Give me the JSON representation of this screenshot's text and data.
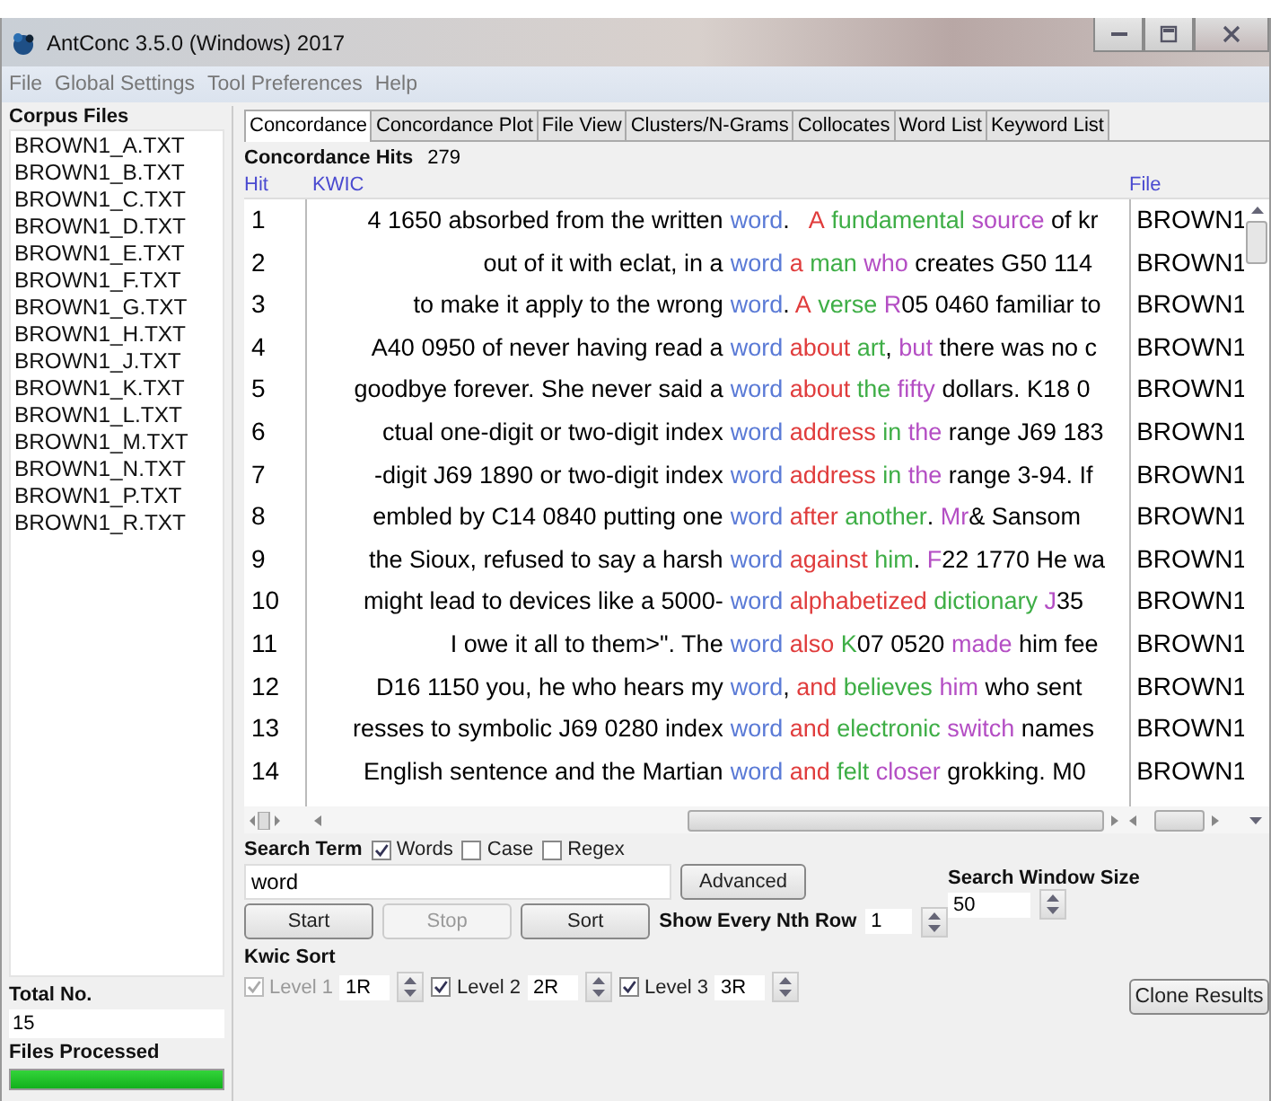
{
  "window": {
    "title": "AntConc 3.5.0 (Windows) 2017"
  },
  "menu": [
    "File",
    "Global Settings",
    "Tool Preferences",
    "Help"
  ],
  "sidebar": {
    "title": "Corpus Files",
    "files": [
      "BROWN1_A.TXT",
      "BROWN1_B.TXT",
      "BROWN1_C.TXT",
      "BROWN1_D.TXT",
      "BROWN1_E.TXT",
      "BROWN1_F.TXT",
      "BROWN1_G.TXT",
      "BROWN1_H.TXT",
      "BROWN1_J.TXT",
      "BROWN1_K.TXT",
      "BROWN1_L.TXT",
      "BROWN1_M.TXT",
      "BROWN1_N.TXT",
      "BROWN1_P.TXT",
      "BROWN1_R.TXT"
    ],
    "total_label": "Total No.",
    "total_value": "15",
    "processed_label": "Files Processed",
    "progress": {
      "level": 1
    }
  },
  "tabs": [
    {
      "label": "Concordance",
      "selected": true
    },
    {
      "label": "Concordance Plot",
      "selected": false
    },
    {
      "label": "File View",
      "selected": false
    },
    {
      "label": "Clusters/N-Grams",
      "selected": false
    },
    {
      "label": "Collocates",
      "selected": false
    },
    {
      "label": "Word List",
      "selected": false
    },
    {
      "label": "Keyword List",
      "selected": false
    }
  ],
  "concordance": {
    "hits_label": "Concordance Hits",
    "hits_value": "279",
    "columns": [
      "Hit",
      "KWIC",
      "File"
    ],
    "rows": [
      {
        "hit": "1",
        "left": "4 1650 absorbed from the written",
        "segments": [
          {
            "text": "word",
            "color": "#5a7ad6"
          },
          {
            "text": ".  "
          },
          {
            "text": " A",
            "color": "#e03c3c"
          },
          {
            "text": " fundamental",
            "color": "#3eae46"
          },
          {
            "text": " source",
            "color": "#b44ec4"
          },
          {
            "text": " of kr"
          }
        ],
        "file": "BROWN1"
      },
      {
        "hit": "2",
        "left": "out of it with eclat, in a",
        "segments": [
          {
            "text": "word",
            "color": "#5a7ad6"
          },
          {
            "text": " a",
            "color": "#e03c3c"
          },
          {
            "text": " man",
            "color": "#3eae46"
          },
          {
            "text": " who",
            "color": "#b44ec4"
          },
          {
            "text": " creates G50 114"
          }
        ],
        "file": "BROWN1"
      },
      {
        "hit": "3",
        "left": "to make it apply to the wrong",
        "segments": [
          {
            "text": "word",
            "color": "#5a7ad6"
          },
          {
            "text": "."
          },
          {
            "text": " A",
            "color": "#e03c3c"
          },
          {
            "text": " verse",
            "color": "#3eae46"
          },
          {
            "text": " R",
            "color": "#b44ec4"
          },
          {
            "text": "05 0460 familiar to"
          }
        ],
        "file": "BROWN1"
      },
      {
        "hit": "4",
        "left": "A40 0950 of never having read a",
        "segments": [
          {
            "text": "word",
            "color": "#5a7ad6"
          },
          {
            "text": " about",
            "color": "#e03c3c"
          },
          {
            "text": " art",
            "color": "#3eae46"
          },
          {
            "text": ","
          },
          {
            "text": " but",
            "color": "#b44ec4"
          },
          {
            "text": " there was no c"
          }
        ],
        "file": "BROWN1"
      },
      {
        "hit": "5",
        "left": "goodbye forever. She never said a",
        "segments": [
          {
            "text": "word",
            "color": "#5a7ad6"
          },
          {
            "text": " about",
            "color": "#e03c3c"
          },
          {
            "text": " the",
            "color": "#3eae46"
          },
          {
            "text": " fifty",
            "color": "#b44ec4"
          },
          {
            "text": " dollars. K18 0"
          }
        ],
        "file": "BROWN1"
      },
      {
        "hit": "6",
        "left": "ctual one-digit or two-digit index",
        "segments": [
          {
            "text": "word",
            "color": "#5a7ad6"
          },
          {
            "text": " address",
            "color": "#e03c3c"
          },
          {
            "text": " in",
            "color": "#3eae46"
          },
          {
            "text": " the",
            "color": "#b44ec4"
          },
          {
            "text": " range J69 183"
          }
        ],
        "file": "BROWN1"
      },
      {
        "hit": "7",
        "left": "-digit J69 1890 or two-digit index",
        "segments": [
          {
            "text": "word",
            "color": "#5a7ad6"
          },
          {
            "text": " address",
            "color": "#e03c3c"
          },
          {
            "text": " in",
            "color": "#3eae46"
          },
          {
            "text": " the",
            "color": "#b44ec4"
          },
          {
            "text": " range 3-94. If"
          }
        ],
        "file": "BROWN1"
      },
      {
        "hit": "8",
        "left": "embled by C14 0840 putting one",
        "segments": [
          {
            "text": "word",
            "color": "#5a7ad6"
          },
          {
            "text": " after",
            "color": "#e03c3c"
          },
          {
            "text": " another",
            "color": "#3eae46"
          },
          {
            "text": "."
          },
          {
            "text": " Mr",
            "color": "#b44ec4"
          },
          {
            "text": "& Sansom"
          }
        ],
        "file": "BROWN1"
      },
      {
        "hit": "9",
        "left": "the Sioux, refused to say a harsh",
        "segments": [
          {
            "text": "word",
            "color": "#5a7ad6"
          },
          {
            "text": " against",
            "color": "#e03c3c"
          },
          {
            "text": " him",
            "color": "#3eae46"
          },
          {
            "text": "."
          },
          {
            "text": " F",
            "color": "#b44ec4"
          },
          {
            "text": "22 1770 He wa"
          }
        ],
        "file": "BROWN1"
      },
      {
        "hit": "10",
        "left": "might lead to devices like a 5000-",
        "segments": [
          {
            "text": "word",
            "color": "#5a7ad6"
          },
          {
            "text": " alphabetized",
            "color": "#e03c3c"
          },
          {
            "text": " dictionary",
            "color": "#3eae46"
          },
          {
            "text": " J",
            "color": "#b44ec4"
          },
          {
            "text": "35"
          }
        ],
        "file": "BROWN1"
      },
      {
        "hit": "11",
        "left": "I owe it all to them>\". The",
        "segments": [
          {
            "text": "word",
            "color": "#5a7ad6"
          },
          {
            "text": " also",
            "color": "#e03c3c"
          },
          {
            "text": " K",
            "color": "#3eae46"
          },
          {
            "text": "07 0520"
          },
          {
            "text": " made",
            "color": "#b44ec4"
          },
          {
            "text": " him fee"
          }
        ],
        "file": "BROWN1"
      },
      {
        "hit": "12",
        "left": "D16 1150 you, he who hears my",
        "segments": [
          {
            "text": "word",
            "color": "#5a7ad6",
            "trail": ","
          },
          {
            "text": " and",
            "color": "#e03c3c"
          },
          {
            "text": " believes",
            "color": "#3eae46"
          },
          {
            "text": " him",
            "color": "#b44ec4"
          },
          {
            "text": " who sent"
          }
        ],
        "file": "BROWN1"
      },
      {
        "hit": "13",
        "left": "resses to symbolic J69 0280 index",
        "segments": [
          {
            "text": "word",
            "color": "#5a7ad6"
          },
          {
            "text": " and",
            "color": "#e03c3c"
          },
          {
            "text": " electronic",
            "color": "#3eae46"
          },
          {
            "text": " switch",
            "color": "#b44ec4"
          },
          {
            "text": " names"
          }
        ],
        "file": "BROWN1"
      },
      {
        "hit": "14",
        "left": "English sentence and the Martian",
        "segments": [
          {
            "text": "word",
            "color": "#5a7ad6"
          },
          {
            "text": " and",
            "color": "#e03c3c"
          },
          {
            "text": " felt",
            "color": "#3eae46"
          },
          {
            "text": " closer",
            "color": "#b44ec4"
          },
          {
            "text": " grokking. M0"
          }
        ],
        "file": "BROWN1"
      }
    ]
  },
  "search": {
    "label": "Search Term",
    "options": [
      {
        "label": "Words",
        "checked": true
      },
      {
        "label": "Case",
        "checked": false
      },
      {
        "label": "Regex",
        "checked": false
      }
    ],
    "value": "word",
    "advanced": "Advanced",
    "window_size_label": "Search Window Size",
    "window_size": "50",
    "buttons": [
      {
        "label": "Start",
        "disabled": false
      },
      {
        "label": "Stop",
        "disabled": true
      },
      {
        "label": "Sort",
        "disabled": false
      }
    ],
    "nth_label": "Show Every Nth Row",
    "nth_value": "1"
  },
  "kwic_sort": {
    "label": "Kwic Sort",
    "levels": [
      {
        "label": "Level 1",
        "value": "1R",
        "checked": true,
        "disabled": true
      },
      {
        "label": "Level 2",
        "value": "2R",
        "checked": true,
        "disabled": false
      },
      {
        "label": "Level 3",
        "value": "3R",
        "checked": true,
        "disabled": false
      }
    ],
    "clone": "Clone Results"
  }
}
